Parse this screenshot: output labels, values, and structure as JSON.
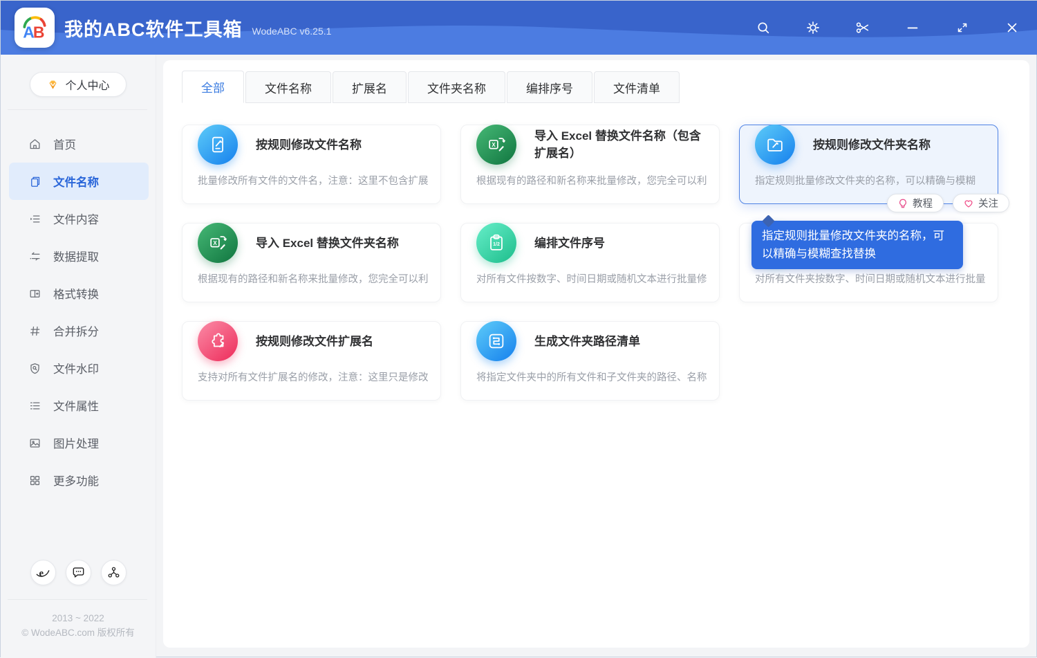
{
  "header": {
    "logo_text": "AB",
    "title": "我的ABC软件工具箱",
    "version": "WodeABC v6.25.1",
    "action_icons": [
      "search",
      "settings-gear",
      "scissors",
      "minimize",
      "resize",
      "close"
    ]
  },
  "sidebar": {
    "profile_button": {
      "label": "个人中心",
      "icon": "vip-diamond"
    },
    "items": [
      {
        "label": "首页",
        "icon": "home",
        "selected": false
      },
      {
        "label": "文件名称",
        "icon": "file-name",
        "selected": true
      },
      {
        "label": "文件内容",
        "icon": "file-content",
        "selected": false
      },
      {
        "label": "数据提取",
        "icon": "data-extract",
        "selected": false
      },
      {
        "label": "格式转换",
        "icon": "format-convert",
        "selected": false
      },
      {
        "label": "合并拆分",
        "icon": "merge-split",
        "selected": false
      },
      {
        "label": "文件水印",
        "icon": "watermark",
        "selected": false
      },
      {
        "label": "文件属性",
        "icon": "file-attributes",
        "selected": false
      },
      {
        "label": "图片处理",
        "icon": "image-process",
        "selected": false
      },
      {
        "label": "更多功能",
        "icon": "more-grid",
        "selected": false
      }
    ],
    "footer": {
      "social_icons": [
        "ie-browser",
        "chat-bubble",
        "share-network"
      ],
      "years": "2013 ~ 2022",
      "copyright": "© WodeABC.com 版权所有"
    }
  },
  "tabs": [
    {
      "label": "全部",
      "active": true
    },
    {
      "label": "文件名称",
      "active": false
    },
    {
      "label": "扩展名",
      "active": false
    },
    {
      "label": "文件夹名称",
      "active": false
    },
    {
      "label": "编排序号",
      "active": false
    },
    {
      "label": "文件清单",
      "active": false
    }
  ],
  "cards": [
    {
      "title": "按规则修改文件名称",
      "desc": "批量修改所有文件的文件名，注意：这里不包含扩展",
      "icon": "edit-document-icon",
      "color": "blue",
      "state": "normal"
    },
    {
      "title": "导入 Excel 替换文件名称（包含扩展名）",
      "desc": "根据现有的路径和新名称来批量修改，您完全可以利",
      "icon": "excel-replace-icon",
      "color": "green",
      "state": "normal"
    },
    {
      "title": "按规则修改文件夹名称",
      "desc": "指定规则批量修改文件夹的名称，可以精确与模糊",
      "icon": "folder-edit-icon",
      "color": "blue",
      "state": "hovered"
    },
    {
      "title": "导入 Excel 替换文件夹名称",
      "desc": "根据现有的路径和新名称来批量修改，您完全可以利",
      "icon": "excel-replace-icon",
      "color": "green",
      "state": "normal"
    },
    {
      "title": "编排文件序号",
      "desc": "对所有文件按数字、时间日期或随机文本进行批量修",
      "icon": "clipboard-number-icon",
      "color": "mint",
      "state": "normal"
    },
    {
      "title": "",
      "desc": "对所有文件夹按数字、时间日期或随机文本进行批量",
      "icon": "clipboard-number-icon",
      "color": "mint",
      "state": "covered-by-tooltip"
    },
    {
      "title": "按规则修改文件扩展名",
      "desc": "支持对所有文件扩展名的修改，注意：这里只是修改",
      "icon": "puzzle-edit-icon",
      "color": "pink",
      "state": "normal"
    },
    {
      "title": "生成文件夹路径清单",
      "desc": "将指定文件夹中的所有文件和子文件夹的路径、名称",
      "icon": "route-list-icon",
      "color": "blue",
      "state": "normal"
    }
  ],
  "hover_card": {
    "buttons": [
      {
        "label": "教程",
        "icon": "lightbulb"
      },
      {
        "label": "关注",
        "icon": "heart"
      }
    ]
  },
  "tooltip": {
    "text": "指定规则批量修改文件夹的名称，可以精确与模糊查找替换"
  },
  "colors": {
    "header_base": "#3964cb",
    "header_wave": "#4c7ce1",
    "accent_blue": "#2a66d9",
    "selected_item_bg": "#e1ecfc",
    "tooltip_bg": "#2f6ce0",
    "card_icon_blue": "#1b86ee",
    "card_icon_green": "#157b44",
    "card_icon_mint": "#23c190",
    "card_icon_pink": "#ee3360",
    "pink_button_icon": "#e8538f"
  }
}
